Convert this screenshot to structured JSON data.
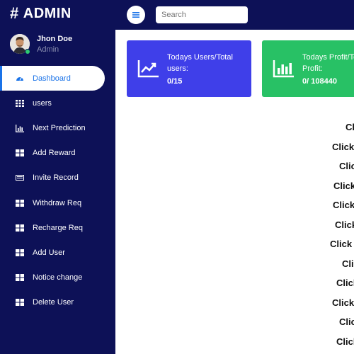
{
  "brand": {
    "title": "# ADMIN",
    "hash": "#",
    "name": "ADMIN"
  },
  "search": {
    "placeholder": "Search"
  },
  "profile": {
    "name": "Jhon Doe",
    "role": "Admin"
  },
  "sidebar": {
    "items": [
      {
        "label": "Dashboard",
        "icon": "dashboard-gauge-icon",
        "active": true
      },
      {
        "label": "users",
        "icon": "grid-icon"
      },
      {
        "label": "Next Prediction",
        "icon": "bar-chart-icon"
      },
      {
        "label": "Add Reward",
        "icon": "table-icon"
      },
      {
        "label": "Invite Record",
        "icon": "keyboard-icon"
      },
      {
        "label": "Withdraw Req",
        "icon": "table-icon"
      },
      {
        "label": "Recharge Req",
        "icon": "table-icon"
      },
      {
        "label": "Add User",
        "icon": "table-icon"
      },
      {
        "label": "Notice change",
        "icon": "table-icon"
      },
      {
        "label": "Delete User",
        "icon": "table-icon"
      }
    ]
  },
  "cards": {
    "users": {
      "title": "Todays Users/Total users:",
      "title_line1": "Todays Users/Total",
      "title_line2": "users:",
      "value": "0/15",
      "icon": "trend-chart-icon"
    },
    "profit": {
      "title_line1": "Todays Profit/To",
      "title_line2": "Profit:",
      "value": "0/ 108440",
      "icon": "bar-chart-icon"
    }
  },
  "clicks": [
    "Cli",
    "Click",
    "Clic",
    "Click",
    "Click",
    "Click",
    "Click I",
    "Cli",
    "Click",
    "Click",
    "Clic",
    "Click"
  ],
  "colors": {
    "sidebar": "#0d1157",
    "active": "#1a73e8",
    "card_users": "#3f3fe9",
    "card_profit": "#28c165"
  }
}
